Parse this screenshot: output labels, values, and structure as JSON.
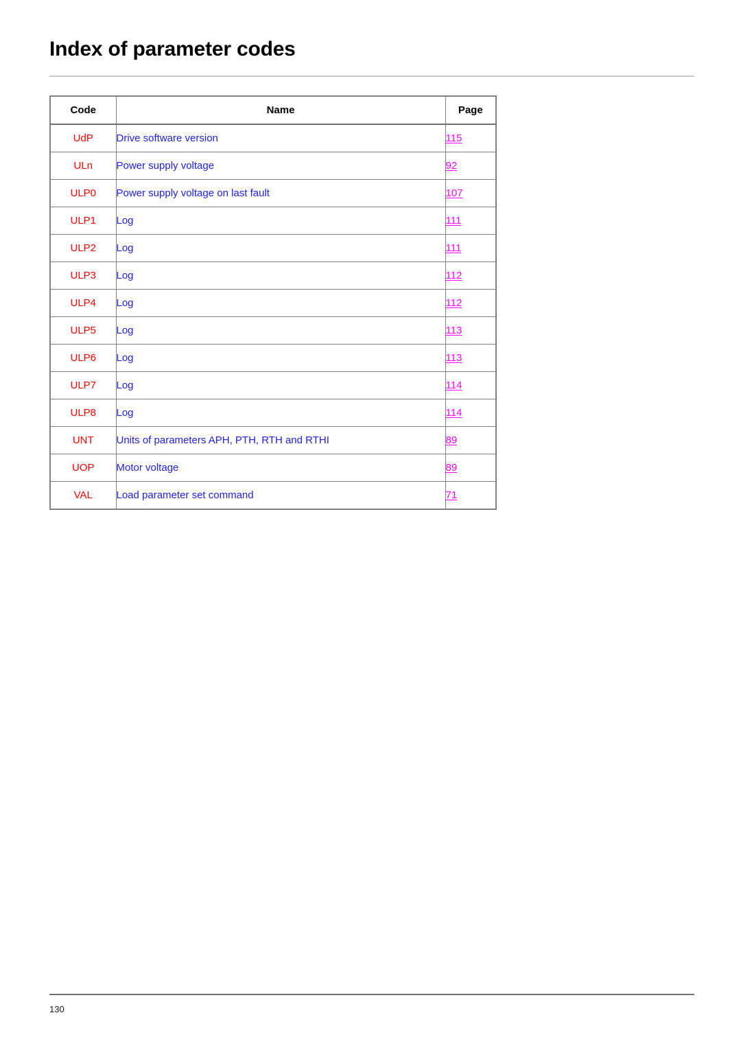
{
  "document": {
    "title": "Index of parameter codes",
    "footer_page_number": "130"
  },
  "colors": {
    "code": "#ff0000",
    "name": "#2020ee",
    "page_link": "#ff00ff",
    "border": "#808080",
    "title_rule": "#c6c6c6",
    "footer_rule": "#6e6e6e"
  },
  "table": {
    "headers": {
      "code": "Code",
      "name": "Name",
      "page": "Page"
    },
    "rows": [
      {
        "code": "UdP",
        "name": "Drive software version",
        "page": "115"
      },
      {
        "code": "ULn",
        "name": "Power supply voltage",
        "page": "92"
      },
      {
        "code": "ULP0",
        "name": "Power supply voltage on last fault",
        "page": "107"
      },
      {
        "code": "ULP1",
        "name": "Log",
        "page": "111"
      },
      {
        "code": "ULP2",
        "name": "Log",
        "page": "111"
      },
      {
        "code": "ULP3",
        "name": "Log",
        "page": "112"
      },
      {
        "code": "ULP4",
        "name": "Log",
        "page": "112"
      },
      {
        "code": "ULP5",
        "name": "Log",
        "page": "113"
      },
      {
        "code": "ULP6",
        "name": "Log",
        "page": "113"
      },
      {
        "code": "ULP7",
        "name": "Log",
        "page": "114"
      },
      {
        "code": "ULP8",
        "name": "Log",
        "page": "114"
      },
      {
        "code": "UNT",
        "name": "Units of parameters APH, PTH, RTH and RTHI",
        "page": "89"
      },
      {
        "code": "UOP",
        "name": "Motor voltage",
        "page": "89"
      },
      {
        "code": "VAL",
        "name": "Load parameter set command",
        "page": "71"
      }
    ]
  }
}
